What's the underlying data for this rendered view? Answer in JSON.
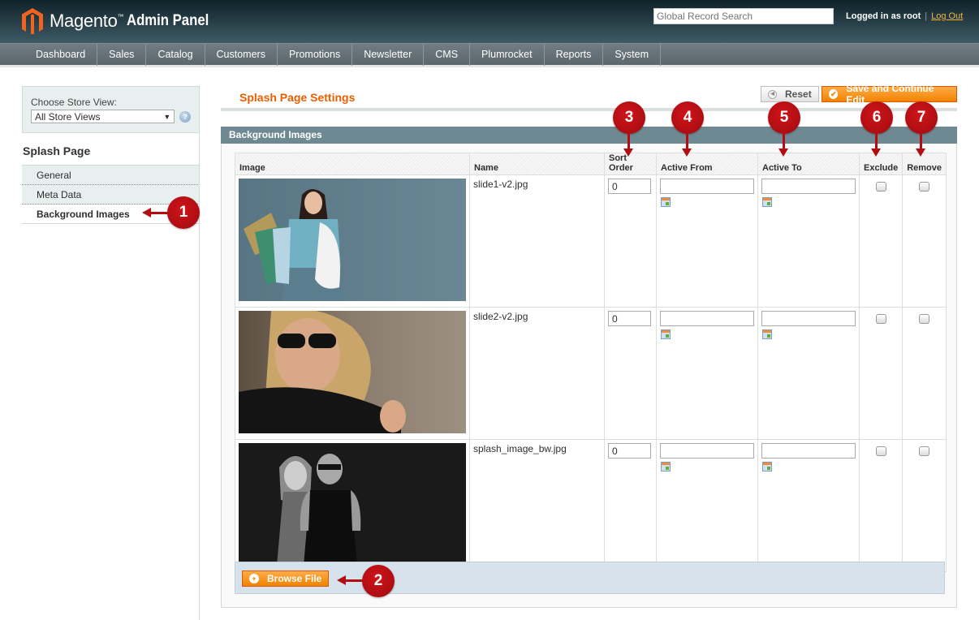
{
  "header": {
    "brand": "Magento",
    "brand_suffix": "Admin Panel",
    "search_placeholder": "Global Record Search",
    "logged_in_text": "Logged in as root",
    "separator": "|",
    "logout_label": "Log Out"
  },
  "nav": {
    "items": [
      {
        "label": "Dashboard"
      },
      {
        "label": "Sales"
      },
      {
        "label": "Catalog"
      },
      {
        "label": "Customers"
      },
      {
        "label": "Promotions"
      },
      {
        "label": "Newsletter"
      },
      {
        "label": "CMS"
      },
      {
        "label": "Plumrocket"
      },
      {
        "label": "Reports"
      },
      {
        "label": "System"
      }
    ]
  },
  "sidebar": {
    "store_view_label": "Choose Store View:",
    "store_view_selected": "All Store Views",
    "help_icon": "?",
    "title": "Splash Page",
    "items": [
      {
        "label": "General",
        "active": false
      },
      {
        "label": "Meta Data",
        "active": false
      },
      {
        "label": "Background Images",
        "active": true
      }
    ]
  },
  "main": {
    "page_title": "Splash Page Settings",
    "reset_label": "Reset",
    "save_label": "Save and Continue Edit",
    "section_title": "Background Images",
    "columns": [
      "Image",
      "Name",
      "Sort Order",
      "Active From",
      "Active To",
      "Exclude",
      "Remove"
    ],
    "rows": [
      {
        "name": "slide1-v2.jpg",
        "sort_order": "0",
        "active_from": "",
        "active_to": "",
        "exclude": false,
        "remove": false
      },
      {
        "name": "slide2-v2.jpg",
        "sort_order": "0",
        "active_from": "",
        "active_to": "",
        "exclude": false,
        "remove": false
      },
      {
        "name": "splash_image_bw.jpg",
        "sort_order": "0",
        "active_from": "",
        "active_to": "",
        "exclude": false,
        "remove": false
      }
    ],
    "browse_label": "Browse File"
  },
  "annotations": [
    "1",
    "2",
    "3",
    "4",
    "5",
    "6",
    "7"
  ],
  "colors": {
    "accent_orange": "#eb5e00",
    "button_orange": "#f18200",
    "section_header": "#6f8992",
    "annotation_red": "#b30d12",
    "logout_link": "#f5b43c"
  }
}
